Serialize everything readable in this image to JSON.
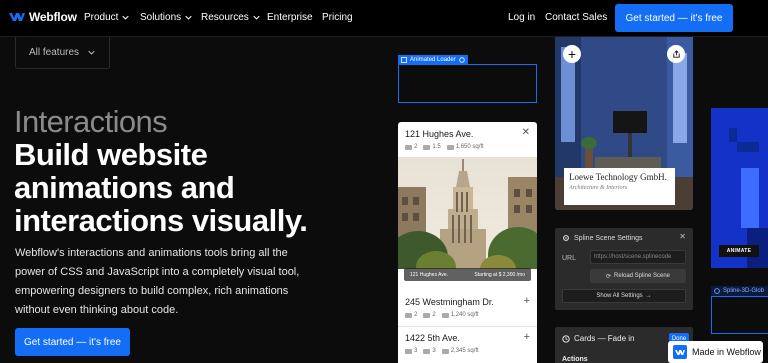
{
  "nav": {
    "brand": "Webflow",
    "items": [
      {
        "label": "Product",
        "has_dropdown": true
      },
      {
        "label": "Solutions",
        "has_dropdown": true
      },
      {
        "label": "Resources",
        "has_dropdown": true
      },
      {
        "label": "Enterprise",
        "has_dropdown": false
      },
      {
        "label": "Pricing",
        "has_dropdown": false
      }
    ],
    "login": "Log in",
    "contact": "Contact Sales",
    "cta": "Get started — it's free"
  },
  "hero": {
    "filter_button": "All features",
    "eyebrow": "Interactions",
    "headline": "Build website animations and interactions visually.",
    "description": "Webflow's interactions and animations tools bring all the power of CSS and JavaScript into a completely visual tool, empowering designers to build complex, rich animations without even thinking about code.",
    "cta": "Get started — it's free"
  },
  "loader": {
    "tag": "Animated Loader"
  },
  "listing": {
    "title": "121 Hughes Ave.",
    "beds": "2",
    "baths": "1.5",
    "area": "1,650 sq/ft",
    "photo_caption_left": "121 Hughes Ave.",
    "photo_caption_right": "Starting at $ 2,300 /mo",
    "items": [
      {
        "title": "245 Westmingham Dr.",
        "beds": "2",
        "baths": "2",
        "area": "1,240 sq/ft"
      },
      {
        "title": "1422 5th Ave.",
        "beds": "3",
        "baths": "3",
        "area": "2,345 sq/ft"
      }
    ]
  },
  "interior": {
    "company": "Loewe Technology GmbH.",
    "subtitle": "Architecture & Interiors"
  },
  "spline_panel": {
    "title": "Spline Scene Settings",
    "url_label": "URL",
    "url_placeholder": "https://host/scene.splinecode",
    "reload": "Reload Spline Scene",
    "show_all": "Show All Settings"
  },
  "cards_panel": {
    "title": "Cards — Fade in",
    "done": "Done",
    "actions": "Actions"
  },
  "right": {
    "animate_badge": "ANIMATE",
    "spline_tag": "Spline-3D-Glob"
  },
  "badge": {
    "made_in": "Made in Webflow"
  },
  "colors": {
    "accent": "#146ef5",
    "background": "#0c0c0c",
    "blue_card": "#1432c8"
  }
}
